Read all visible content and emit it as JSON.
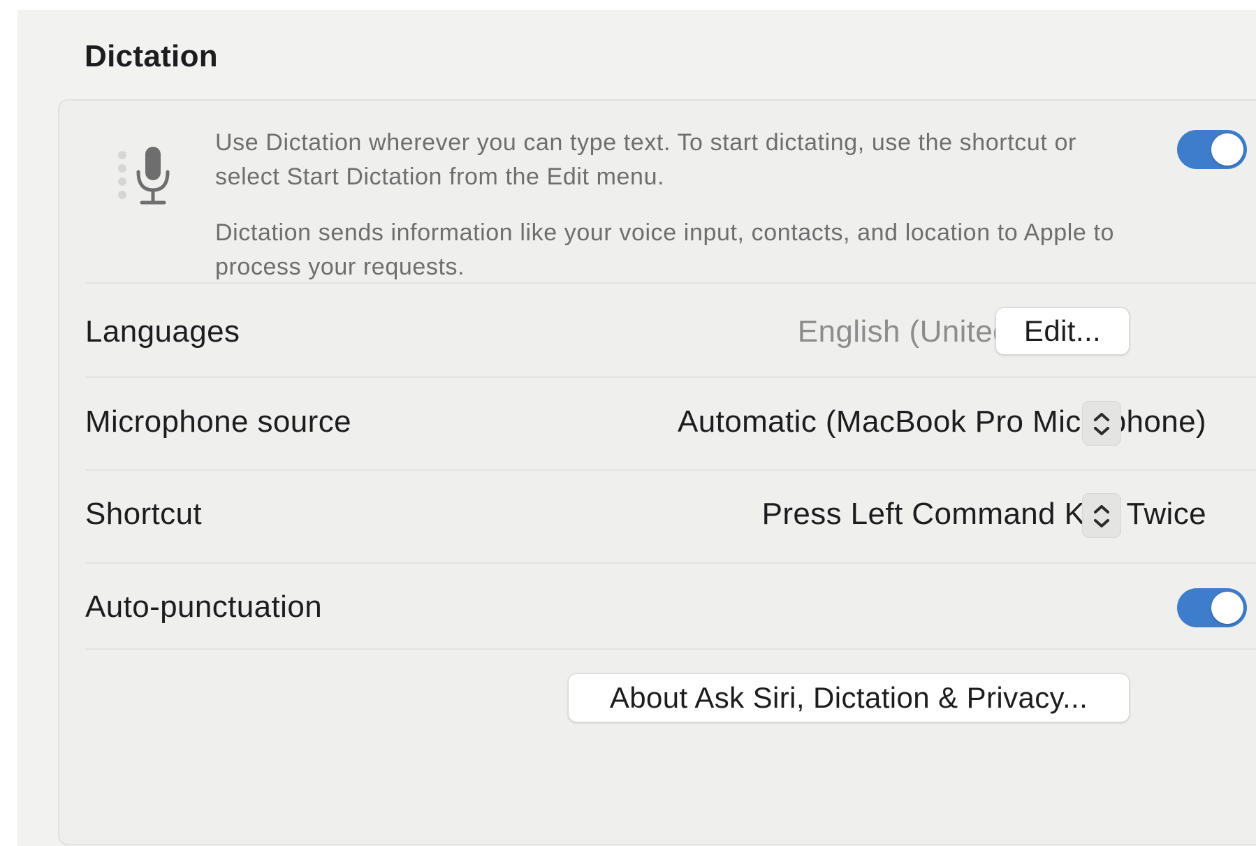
{
  "section": {
    "title": "Dictation"
  },
  "dictation": {
    "description": "Use Dictation wherever you can type text. To start dictating, use the shortcut or select Start Dictation from the Edit menu.",
    "privacy_note": "Dictation sends information like your voice input, contacts, and location to Apple to process your requests.",
    "enabled": true,
    "icon": "microphone-icon"
  },
  "languages": {
    "label": "Languages",
    "value": "English (United States)",
    "edit_button": "Edit..."
  },
  "microphone": {
    "label": "Microphone source",
    "value": "Automatic (MacBook Pro Microphone)"
  },
  "shortcut": {
    "label": "Shortcut",
    "value": "Press Left Command Key Twice"
  },
  "auto_punctuation": {
    "label": "Auto-punctuation",
    "enabled": true
  },
  "about_button": "About Ask Siri, Dictation & Privacy...",
  "colors": {
    "accent": "#3d7dcb",
    "background": "#f2f2f1",
    "secondary_text": "#6e6e6e"
  }
}
